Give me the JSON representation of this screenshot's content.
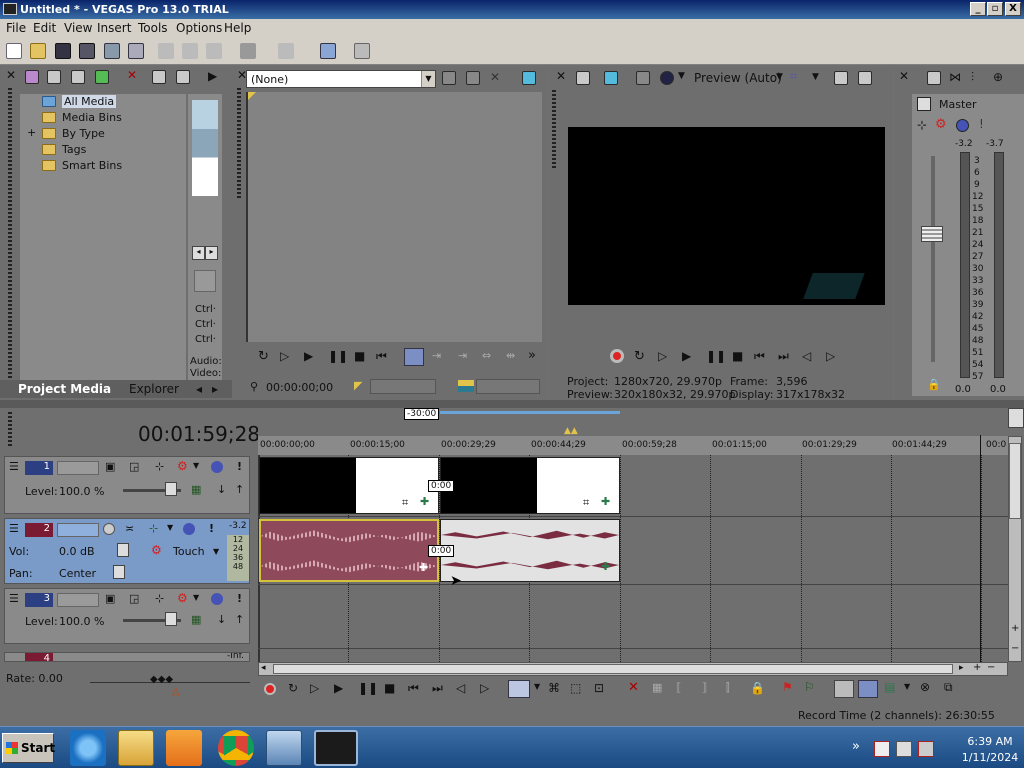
{
  "window": {
    "title": "Untitled * - VEGAS Pro 13.0 TRIAL",
    "min": "_",
    "restore": "▫",
    "close": "X"
  },
  "menu": [
    "File",
    "Edit",
    "View",
    "Insert",
    "Tools",
    "Options",
    "Help"
  ],
  "project_media": {
    "tree": [
      "All Media",
      "Media Bins",
      "By Type",
      "Tags",
      "Smart Bins"
    ],
    "expander": "+",
    "side_labels": [
      "Ctrl·",
      "Ctrl·",
      "Ctrl·",
      "Audio:",
      "Video:"
    ],
    "tabs": [
      "Project Media",
      "Explorer"
    ]
  },
  "trimmer": {
    "dropdown_value": "(None)",
    "timecode": "00:00:00;00"
  },
  "preview": {
    "mode": "Preview (Auto)",
    "project_label": "Project:",
    "project_value": "1280x720, 29.970p",
    "frame_label": "Frame:",
    "frame_value": "3,596",
    "preview_label": "Preview:",
    "preview_value": "320x180x32, 29.970p",
    "display_label": "Display:",
    "display_value": "317x178x32"
  },
  "master": {
    "label": "Master",
    "left_peak": "-3.2",
    "right_peak": "-3.7",
    "scale": [
      "3",
      "6",
      "9",
      "12",
      "15",
      "18",
      "21",
      "24",
      "27",
      "30",
      "33",
      "36",
      "39",
      "42",
      "45",
      "48",
      "51",
      "54",
      "57"
    ],
    "bottom_left": "0.0",
    "bottom_right": "0.0"
  },
  "timeline": {
    "time": "00:01:59;28",
    "marker": "-30:00",
    "ruler": [
      "00:00:00;00",
      "00:00:15;00",
      "00:00:29;29",
      "00:00:44;29",
      "00:00:59;28",
      "00:01:15;00",
      "00:01:29;29",
      "00:01:44;29",
      "00:0"
    ],
    "clip_label": "0:00",
    "tracks": [
      {
        "num": "1",
        "level_label": "Level:",
        "level_value": "100.0 %"
      },
      {
        "num": "2",
        "vol_label": "Vol:",
        "vol_value": "0.0 dB",
        "automation": "Touch",
        "pan_label": "Pan:",
        "pan_value": "Center",
        "peak": "-3.2",
        "meter": [
          "12",
          "24",
          "36",
          "48"
        ]
      },
      {
        "num": "3",
        "level_label": "Level:",
        "level_value": "100.0 %"
      },
      {
        "num": "4",
        "peak": "-Inf."
      }
    ],
    "rate": "Rate: 0.00"
  },
  "status": {
    "record_time": "Record Time (2 channels): 26:30:55"
  },
  "taskbar": {
    "start": "Start",
    "chevron": "»",
    "time": "6:39 AM",
    "date": "1/11/2024"
  }
}
